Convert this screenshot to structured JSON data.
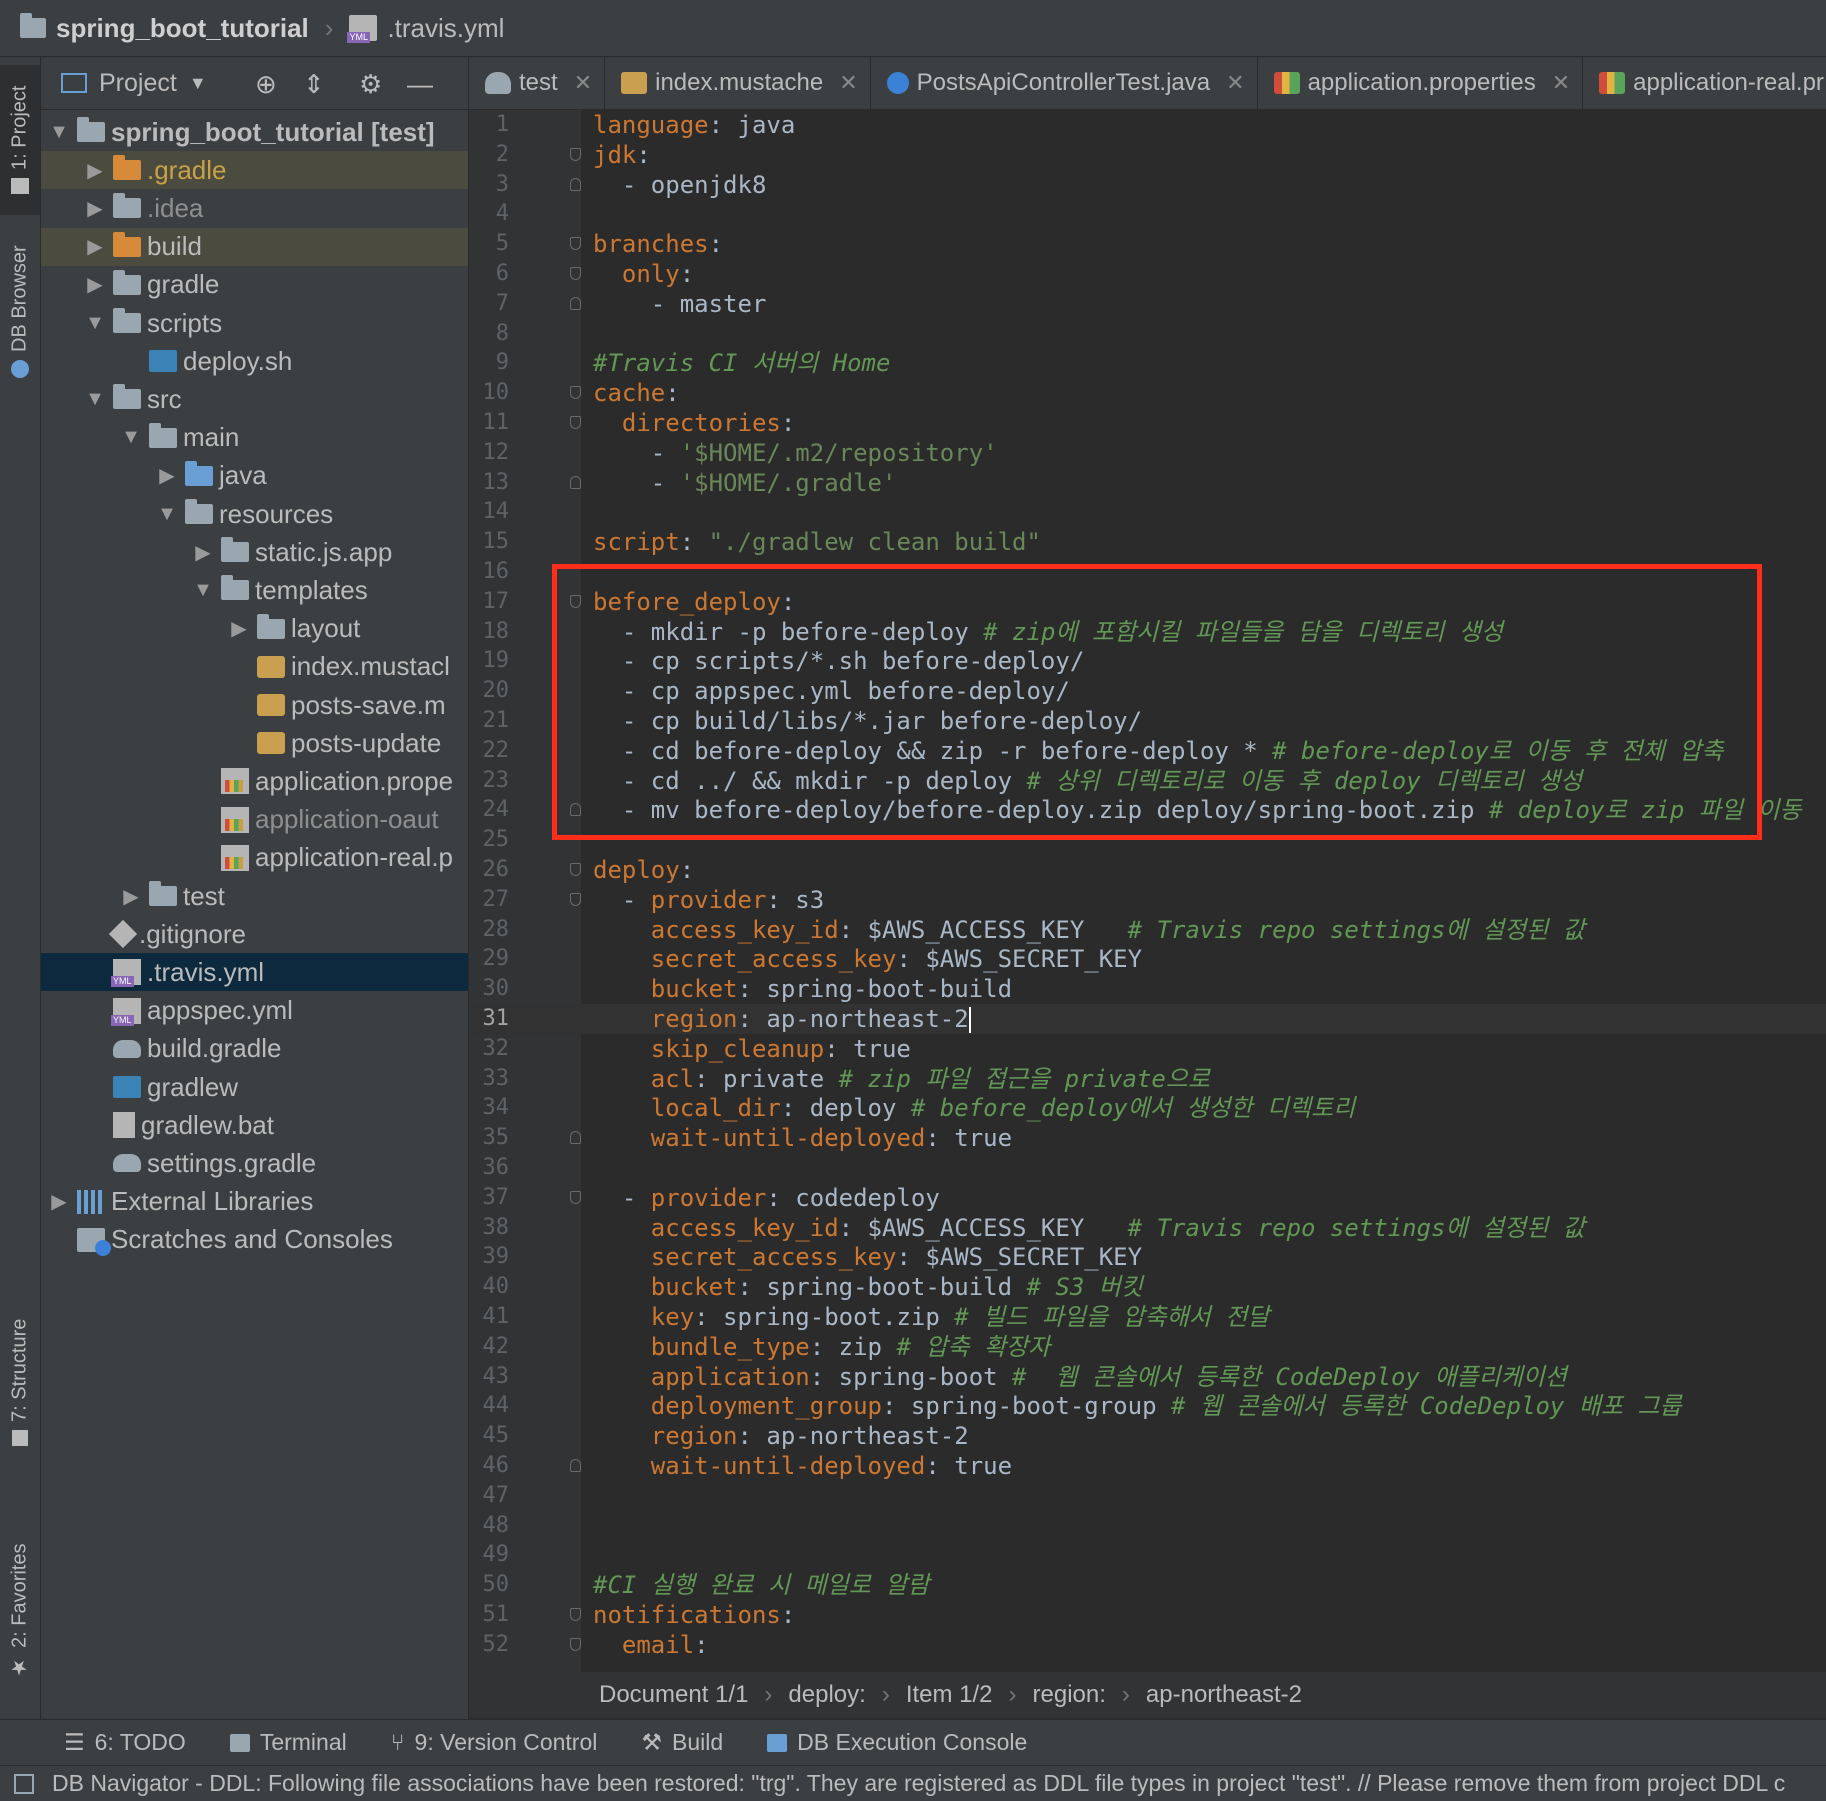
{
  "titlebar": {
    "project": "spring_boot_tutorial",
    "file": ".travis.yml"
  },
  "left_strip": {
    "project_tab": "1: Project",
    "db_browser_tab": "DB Browser",
    "structure_tab": "7: Structure",
    "favorites_tab": "2: Favorites"
  },
  "project_panel": {
    "header_label": "Project",
    "tree": [
      {
        "label": "spring_boot_tutorial [test]",
        "icon": "module-folder-icon"
      },
      {
        "label": ".gradle",
        "icon": "excluded-folder-icon"
      },
      {
        "label": ".idea",
        "icon": "folder-icon"
      },
      {
        "label": "build",
        "icon": "excluded-folder-icon"
      },
      {
        "label": "gradle",
        "icon": "folder-icon"
      },
      {
        "label": "scripts",
        "icon": "folder-icon"
      },
      {
        "label": "deploy.sh",
        "icon": "shell-script-icon"
      },
      {
        "label": "src",
        "icon": "folder-icon"
      },
      {
        "label": "main",
        "icon": "source-folder-icon"
      },
      {
        "label": "java",
        "icon": "java-folder-icon"
      },
      {
        "label": "resources",
        "icon": "resources-folder-icon"
      },
      {
        "label": "static.js.app",
        "icon": "package-folder-icon"
      },
      {
        "label": "templates",
        "icon": "package-folder-icon"
      },
      {
        "label": "layout",
        "icon": "package-folder-icon"
      },
      {
        "label": "index.mustacl",
        "icon": "mustache-file-icon"
      },
      {
        "label": "posts-save.m",
        "icon": "mustache-file-icon"
      },
      {
        "label": "posts-update",
        "icon": "mustache-file-icon"
      },
      {
        "label": "application.prope",
        "icon": "properties-file-icon"
      },
      {
        "label": "application-oaut",
        "icon": "properties-file-icon"
      },
      {
        "label": "application-real.p",
        "icon": "properties-file-icon"
      },
      {
        "label": "test",
        "icon": "test-folder-icon"
      },
      {
        "label": ".gitignore",
        "icon": "gitignore-file-icon"
      },
      {
        "label": ".travis.yml",
        "icon": "yml-file-icon"
      },
      {
        "label": "appspec.yml",
        "icon": "yml-file-icon"
      },
      {
        "label": "build.gradle",
        "icon": "gradle-file-icon"
      },
      {
        "label": "gradlew",
        "icon": "shell-script-icon"
      },
      {
        "label": "gradlew.bat",
        "icon": "bat-file-icon"
      },
      {
        "label": "settings.gradle",
        "icon": "gradle-file-icon"
      },
      {
        "label": "External Libraries",
        "icon": "libraries-icon"
      },
      {
        "label": "Scratches and Consoles",
        "icon": "scratches-icon"
      }
    ]
  },
  "tabs": [
    {
      "label": "test",
      "icon": "gradle-tab-icon"
    },
    {
      "label": "index.mustache",
      "icon": "mustache-tab-icon"
    },
    {
      "label": "PostsApiControllerTest.java",
      "icon": "java-class-tab-icon"
    },
    {
      "label": "application.properties",
      "icon": "properties-tab-icon"
    },
    {
      "label": "application-real.pr",
      "icon": "properties-tab-icon"
    }
  ],
  "editor": {
    "line_numbers": [
      "1",
      "2",
      "3",
      "4",
      "5",
      "6",
      "7",
      "8",
      "9",
      "10",
      "11",
      "12",
      "13",
      "14",
      "15",
      "16",
      "17",
      "18",
      "19",
      "20",
      "21",
      "22",
      "23",
      "24",
      "25",
      "26",
      "27",
      "28",
      "29",
      "30",
      "31",
      "32",
      "33",
      "34",
      "35",
      "36",
      "37",
      "38",
      "39",
      "40",
      "41",
      "42",
      "43",
      "44",
      "45",
      "46",
      "47",
      "48",
      "49",
      "50",
      "51",
      "52"
    ],
    "current_line": "31",
    "lines": {
      "l1k": "language",
      "l1v": ": java",
      "l2k": "jdk",
      "l2v": ":",
      "l3": "  - openjdk8",
      "l5k": "branches",
      "l5v": ":",
      "l6k": "only",
      "l6v": ":",
      "l7": "    - master",
      "l9": "#Travis CI 서버의 Home",
      "l10k": "cache",
      "l10v": ":",
      "l11k": "directories",
      "l11v": ":",
      "l12a": "    - ",
      "l12s": "'$HOME/.m2/repository'",
      "l13a": "    - ",
      "l13s": "'$HOME/.gradle'",
      "l15k": "script",
      "l15a": ": ",
      "l15s": "\"./gradlew clean build\"",
      "l17k": "before_deploy",
      "l17v": ":",
      "l18a": "  - mkdir -p before-deploy ",
      "l18c": "# zip에 포함시킬 파일들을 담을 디렉토리 생성",
      "l19": "  - cp scripts/*.sh before-deploy/",
      "l20": "  - cp appspec.yml before-deploy/",
      "l21": "  - cp build/libs/*.jar before-deploy/",
      "l22a": "  - cd before-deploy && zip -r before-deploy * ",
      "l22c": "# before-deploy로 이동 후 전체 압축",
      "l23a": "  - cd ../ && mkdir -p deploy ",
      "l23c": "# 상위 디렉토리로 이동 후 deploy 디렉토리 생성",
      "l24a": "  - mv before-deploy/before-deploy.zip deploy/spring-boot.zip ",
      "l24c": "# deploy로 zip 파일 이동",
      "l26k": "deploy",
      "l26v": ":",
      "l27a": "  - ",
      "l27k": "provider",
      "l27v": ": s3",
      "l28k": "access_key_id",
      "l28v": ": $AWS_ACCESS_KEY   ",
      "l28c": "# Travis repo settings에 설정된 값",
      "l29k": "secret_access_key",
      "l29v": ": $AWS_SECRET_KEY",
      "l30k": "bucket",
      "l30v": ": spring-boot-build",
      "l31k": "region",
      "l31v": ": ap-northeast-2",
      "l32k": "skip_cleanup",
      "l32v": ": true",
      "l33k": "acl",
      "l33v": ": private ",
      "l33c": "# zip 파일 접근을 private으로",
      "l34k": "local_dir",
      "l34v": ": deploy ",
      "l34c": "# before_deploy에서 생성한 디렉토리",
      "l35k": "wait-until-deployed",
      "l35v": ": true",
      "l37a": "  - ",
      "l37k": "provider",
      "l37v": ": codedeploy",
      "l38k": "access_key_id",
      "l38v": ": $AWS_ACCESS_KEY   ",
      "l38c": "# Travis repo settings에 설정된 값",
      "l39k": "secret_access_key",
      "l39v": ": $AWS_SECRET_KEY",
      "l40k": "bucket",
      "l40v": ": spring-boot-build ",
      "l40c": "# S3 버킷",
      "l41k": "key",
      "l41v": ": spring-boot.zip ",
      "l41c": "# 빌드 파일을 압축해서 전달",
      "l42k": "bundle_type",
      "l42v": ": zip ",
      "l42c": "# 압축 확장자",
      "l43k": "application",
      "l43v": ": spring-boot ",
      "l43c": "#  웹 콘솔에서 등록한 CodeDeploy 애플리케이션",
      "l44k": "deployment_group",
      "l44v": ": spring-boot-group ",
      "l44c": "# 웹 콘솔에서 등록한 CodeDeploy 배포 그룹",
      "l45k": "region",
      "l45v": ": ap-northeast-2",
      "l46k": "wait-until-deployed",
      "l46v": ": true",
      "l50": "#CI 실행 완료 시 메일로 알람",
      "l51k": "notifications",
      "l51v": ":",
      "l52k": "email",
      "l52v": ":"
    }
  },
  "editor_breadcrumb": [
    "Document 1/1",
    "deploy:",
    "Item 1/2",
    "region:",
    "ap-northeast-2"
  ],
  "bottom_tools": [
    "6: TODO",
    "Terminal",
    "9: Version Control",
    "Build",
    "DB Execution Console"
  ],
  "status": "DB Navigator - DDL: Following file associations have been restored: \"trg\". They are registered as DDL file types in project \"test\". // Please remove them from project DDL c",
  "colors": {
    "highlight_box": "#ff2d1a",
    "keyword": "#cc7832",
    "string": "#6a8759",
    "comment": "#629755"
  }
}
